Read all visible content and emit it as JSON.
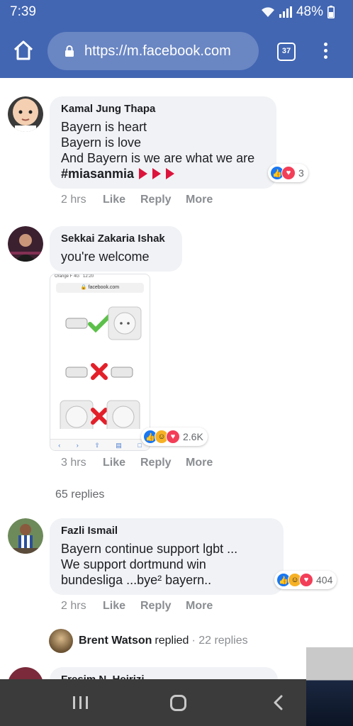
{
  "status_bar": {
    "time": "7:39",
    "battery": "48%"
  },
  "browser": {
    "url": "https://m.facebook.com",
    "tab_count": "37"
  },
  "comments": [
    {
      "author": "Kamal Jung Thapa",
      "lines": [
        "Bayern is heart",
        "Bayern is love",
        "And Bayern is we are what we are"
      ],
      "hashtag": "#miasanmia",
      "reaction_count": "3",
      "time": "2 hrs"
    },
    {
      "author": "Sekkai Zakaria Ishak",
      "lines": [
        "you're welcome"
      ],
      "reaction_count": "2.6K",
      "time": "3 hrs",
      "attachment": {
        "carrier": "Orange F 4G",
        "clock": "12:20",
        "url": "facebook.com"
      }
    },
    {
      "author": "Fazli Ismail",
      "lines": [
        "Bayern continue support lgbt ...",
        "We support dortmund win",
        "bundesliga ...bye² bayern.."
      ],
      "reaction_count": "404",
      "time": "2 hrs"
    }
  ],
  "actions": {
    "like": "Like",
    "reply": "Reply",
    "more": "More"
  },
  "replies_link": "65 replies",
  "sub_reply": {
    "name": "Brent Watson",
    "text": "replied",
    "count": "· 22 replies"
  },
  "partial_comment": {
    "author": "Fresim N. Heirizi"
  },
  "colors": {
    "header": "#4266b2",
    "bubble": "#f0f2f5",
    "like": "#1877f2",
    "love": "#f33e58",
    "haha": "#f7b125"
  },
  "icons": [
    "home-icon",
    "lock-icon",
    "tabs-icon",
    "menu-icon",
    "recent-apps-icon",
    "nav-home-icon",
    "back-icon"
  ]
}
